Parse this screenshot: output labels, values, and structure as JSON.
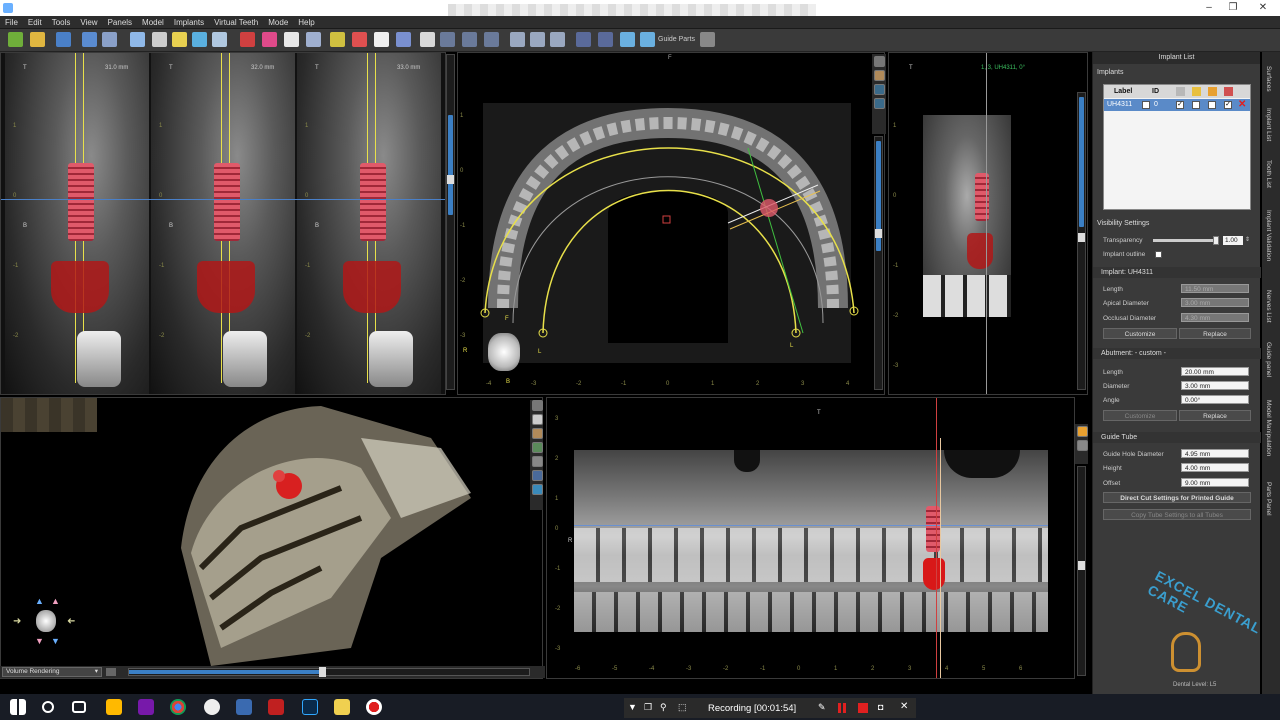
{
  "menubar": {
    "items": [
      "File",
      "Edit",
      "Tools",
      "View",
      "Panels",
      "Model",
      "Implants",
      "Virtual Teeth",
      "Mode",
      "Help"
    ]
  },
  "toolbar": {
    "guide_parts_label": "Guide Parts"
  },
  "cross_sections": {
    "sections": [
      {
        "top_label": "T",
        "distance": "31.0 mm"
      },
      {
        "top_label": "T",
        "distance": "32.0 mm"
      },
      {
        "top_label": "T",
        "distance": "33.0 mm"
      }
    ],
    "side_labels": [
      "B",
      "B",
      "B"
    ],
    "ruler_ticks": [
      "1",
      "0",
      "-1",
      "-2",
      "1",
      "0",
      "-1",
      "-2",
      "1",
      "0",
      "-1",
      "-2"
    ]
  },
  "axial_view": {
    "top_marker": "F",
    "bottom_marker": "B",
    "left_marker": "R",
    "arch_labels": [
      "F",
      "L",
      "L"
    ],
    "ruler_ticks": [
      "-4",
      "-3",
      "-2",
      "-1",
      "0",
      "1",
      "2",
      "3",
      "4",
      "1",
      "0",
      "-1",
      "-2",
      "-3"
    ]
  },
  "tangential_view": {
    "top_marker": "T",
    "info_text": "1, 3, UH4311, 0°",
    "ruler_ticks": [
      "1",
      "0",
      "-1",
      "-2",
      "-3"
    ]
  },
  "volume_view": {
    "render_mode": "Volume Rendering"
  },
  "panoramic_view": {
    "top_marker": "T",
    "left_marker": "R",
    "ruler_ticks_y": [
      "3",
      "2",
      "1",
      "0",
      "-1",
      "-2",
      "-3"
    ],
    "ruler_ticks_x": [
      "-6",
      "-5",
      "-4",
      "-3",
      "-2",
      "-1",
      "0",
      "1",
      "2",
      "3",
      "4",
      "5",
      "6"
    ]
  },
  "panel": {
    "title": "Implant List",
    "implants_label": "Implants",
    "table_headers": [
      "Label",
      "ID"
    ],
    "table_rows": [
      {
        "label": "UH4311",
        "id": "0"
      }
    ],
    "visibility": {
      "header": "Visibility Settings",
      "transparency_label": "Transparency",
      "transparency_value": "1.00",
      "transparency_level": 1.0,
      "outline_label": "Implant outline"
    },
    "implant": {
      "header": "Implant: UH4311",
      "length_label": "Length",
      "length_value": "11.50 mm",
      "apical_label": "Apical Diameter",
      "apical_value": "3.00 mm",
      "occlusal_label": "Occlusal Diameter",
      "occlusal_value": "4.30 mm",
      "customize_label": "Customize",
      "replace_label": "Replace"
    },
    "abutment": {
      "header": "Abutment: - custom -",
      "length_label": "Length",
      "length_value": "20.00 mm",
      "diameter_label": "Diameter",
      "diameter_value": "3.00 mm",
      "angle_label": "Angle",
      "angle_value": "0.00°",
      "customize_label": "Customize",
      "replace_label": "Replace"
    },
    "guide_tube": {
      "header": "Guide Tube",
      "hole_label": "Guide Hole Diameter",
      "hole_value": "4.95 mm",
      "height_label": "Height",
      "height_value": "4.00 mm",
      "offset_label": "Offset",
      "offset_value": "9.00 mm",
      "direct_cut_label": "Direct Cut Settings for Printed Guide",
      "copy_label": "Copy Tube Settings to all Tubes"
    }
  },
  "side_tabs": [
    "Surfaces",
    "Implant List",
    "Tooth List",
    "Implant Validation",
    "Nerves List",
    "Guide panel",
    "Model Manipulation",
    "Parts Panel"
  ],
  "watermark": {
    "text": "EXCEL DENTAL CARE",
    "sub": "Dental Level: L5"
  },
  "recording": {
    "label": "Recording [00:01:54]"
  },
  "colors": {
    "accent": "#3b7fc4",
    "implant": "#e05a6a",
    "crown": "#b01818",
    "guide_line": "#e8e04a"
  }
}
